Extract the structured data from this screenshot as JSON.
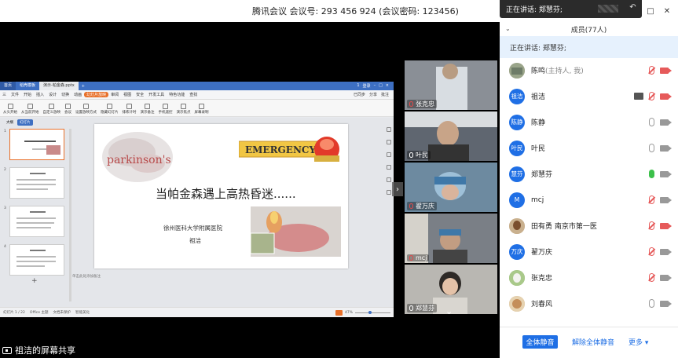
{
  "meeting": {
    "info": "腾讯会议 会议号: 293 456 924  (会议密码: 123456)"
  },
  "speaking_popup": {
    "text": "正在讲话: 郑慧芬;"
  },
  "panel": {
    "members_title": "成员(77人)",
    "speaking_now": "正在讲话: 郑慧芬;",
    "members": [
      {
        "avatar": "",
        "name": "陈鸣",
        "sub": "(主持人, 我)",
        "mic": "off",
        "cam": "off",
        "avatar_style": "photo"
      },
      {
        "avatar": "祖洁",
        "name": "祖洁",
        "sub": "",
        "mic": "off",
        "cam": "off",
        "screen": true,
        "avatar_style": "blue"
      },
      {
        "avatar": "陈静",
        "name": "陈静",
        "sub": "",
        "mic": "normal",
        "cam": "normal",
        "avatar_style": "blue"
      },
      {
        "avatar": "叶民",
        "name": "叶民",
        "sub": "",
        "mic": "normal",
        "cam": "normal",
        "avatar_style": "blue"
      },
      {
        "avatar": "慧芬",
        "name": "郑慧芬",
        "sub": "",
        "mic": "on",
        "cam": "normal",
        "avatar_style": "blue"
      },
      {
        "avatar": "M",
        "name": "mcj",
        "sub": "",
        "mic": "off",
        "cam": "normal",
        "avatar_style": "blue"
      },
      {
        "avatar": "",
        "name": "田有勇 南京市第一医",
        "sub": "",
        "mic": "off",
        "cam": "off",
        "avatar_style": "photo2"
      },
      {
        "avatar": "万庆",
        "name": "翟万庆",
        "sub": "",
        "mic": "off",
        "cam": "normal",
        "avatar_style": "blue"
      },
      {
        "avatar": "",
        "name": "张克忠",
        "sub": "",
        "mic": "off",
        "cam": "normal",
        "avatar_style": "photo3"
      },
      {
        "avatar": "",
        "name": "刘春风",
        "sub": "",
        "mic": "normal",
        "cam": "normal",
        "avatar_style": "photo2"
      }
    ],
    "buttons": {
      "mute_all": "全体静音",
      "unmute_all": "解除全体静音",
      "more": "更多 ▾"
    }
  },
  "videos": [
    {
      "name": "张克忠",
      "mic": "off",
      "bg": "#8a8f96"
    },
    {
      "name": "叶民",
      "mic": "normal",
      "bg": "#5f6670"
    },
    {
      "name": "翟万庆",
      "mic": "off",
      "bg": "#6d8aa0"
    },
    {
      "name": "mcj",
      "mic": "off",
      "bg": "#7a7f86"
    },
    {
      "name": "郑慧芬",
      "mic": "normal",
      "bg": "#b9b7b2"
    }
  ],
  "share": {
    "footer": "祖洁的屏幕共享"
  },
  "wps": {
    "tabs": [
      "首页",
      "稻壳模板",
      "演示-帕金森.pptx"
    ],
    "tab_right": [
      "1",
      "登录"
    ],
    "menu": [
      "三",
      "文件",
      "开始",
      "插入",
      "设计",
      "切换",
      "动画",
      "放映",
      "审阅",
      "视图",
      "安全",
      "开发工具",
      "特色功能",
      "查找"
    ],
    "menu_active": "幻灯片放映",
    "menu_right": [
      "已同步",
      "分享",
      "批注"
    ],
    "ribbon": [
      "从头开始",
      "从当前开始",
      "自定义放映",
      "会议",
      "设置放映方式",
      "隐藏幻灯片",
      "排练计时",
      "演示备注",
      "手机遥控",
      "演示焦点",
      "屏幕录制"
    ],
    "thumb_tabs": [
      "大纲",
      "幻灯片"
    ],
    "thumb_numbers": [
      "1",
      "2",
      "3",
      "4"
    ],
    "notes_placeholder": "单击此处添加备注",
    "status": {
      "slide": "幻灯片 1 / 22",
      "theme": "Office 主题",
      "protect": "文档未保护",
      "beauty": "智能美化",
      "zoom": "47%"
    }
  },
  "slide": {
    "title": "当帕金森遇上高热昏迷......",
    "org": "徐州医科大学附属医院",
    "author": "祖洁",
    "brain_word": "parkinson's",
    "sign_word": "EMERGENCY"
  },
  "colors": {
    "accent": "#1f6fe5",
    "wps_blue": "#3d6fc2",
    "wps_orange": "#e8702a",
    "mic_on": "#3cc04a",
    "muted": "#e65a5a"
  }
}
